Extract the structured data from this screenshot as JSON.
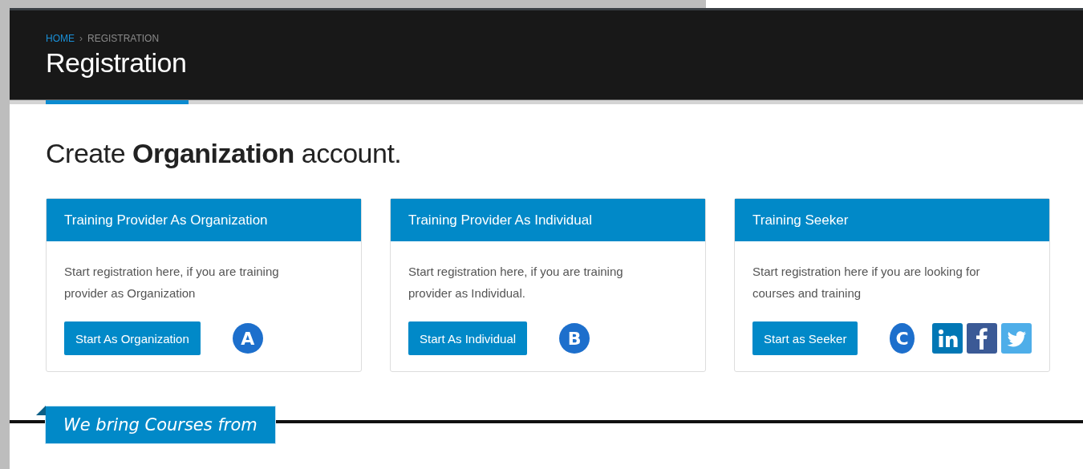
{
  "breadcrumb": {
    "items": [
      {
        "label": "HOME",
        "selected": false
      },
      {
        "label": "REGISTRATION",
        "selected": true
      }
    ],
    "separator": "›"
  },
  "page_title": "Registration",
  "heading": "Create **Organization** account.",
  "cards": [
    {
      "title": "Training Provider As Organization",
      "description": "Start registration here, if you are training provider as Organization",
      "button": "Start As Organization",
      "marker": "A"
    },
    {
      "title": "Training Provider As Individual",
      "description": "Start registration here, if you are training provider as Individual.",
      "button": "Start As Individual",
      "marker": "B"
    },
    {
      "title": "Training Seeker",
      "description": "Start registration here if you are looking for courses and training",
      "button": "Start as Seeker",
      "marker": "C",
      "social": [
        {
          "kind": "linkedin"
        },
        {
          "kind": "facebook"
        },
        {
          "kind": "twitter"
        }
      ]
    }
  ],
  "section_tab": "We bring Courses from"
}
